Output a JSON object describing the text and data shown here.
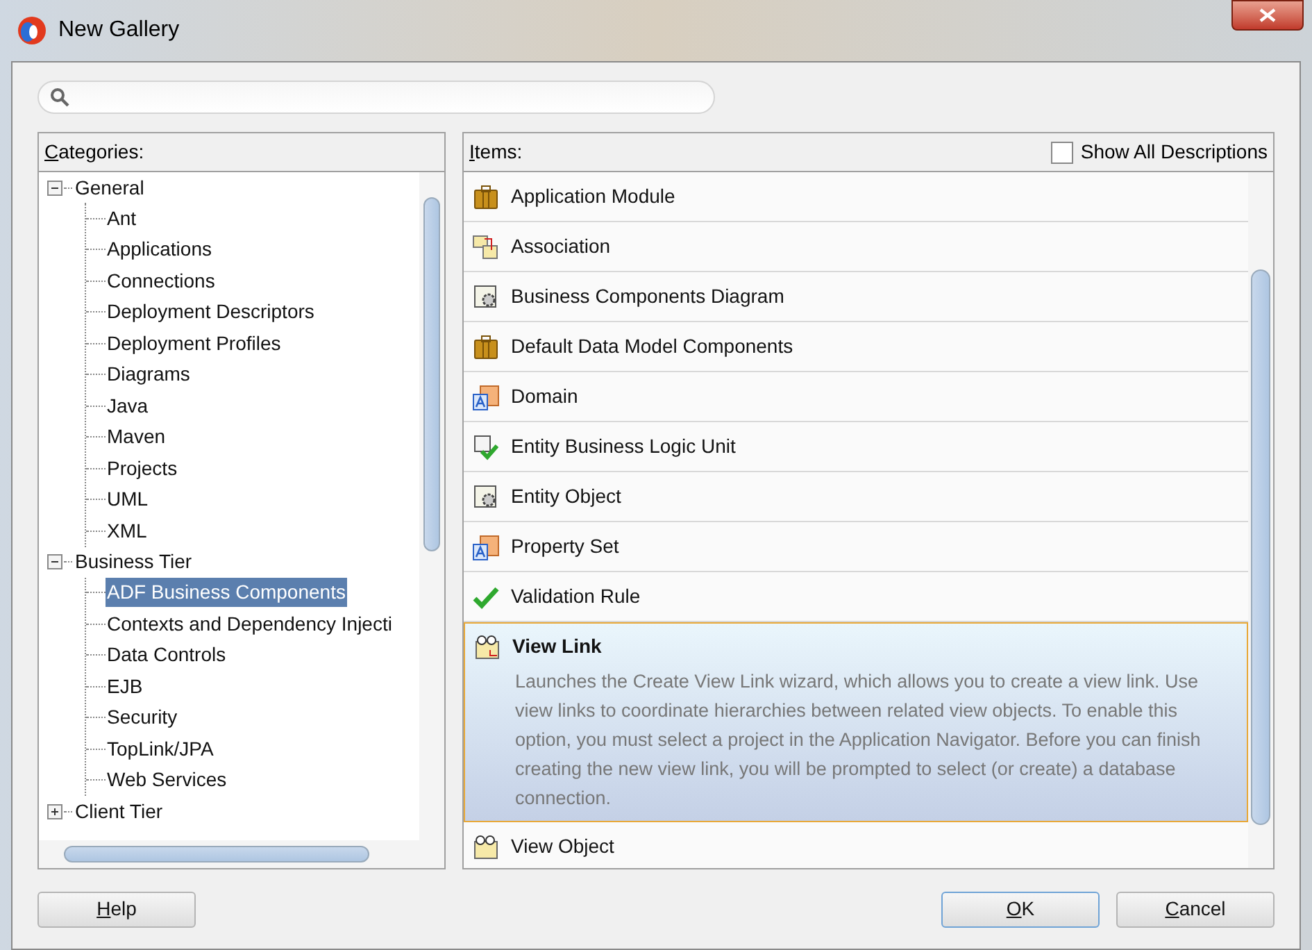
{
  "window": {
    "title": "New Gallery"
  },
  "categories": {
    "label": "Categories:",
    "tree": [
      {
        "label": "General",
        "expanded": true,
        "selected": false,
        "children": [
          {
            "label": "Ant",
            "selected": false
          },
          {
            "label": "Applications",
            "selected": false
          },
          {
            "label": "Connections",
            "selected": false
          },
          {
            "label": "Deployment Descriptors",
            "selected": false
          },
          {
            "label": "Deployment Profiles",
            "selected": false
          },
          {
            "label": "Diagrams",
            "selected": false
          },
          {
            "label": "Java",
            "selected": false
          },
          {
            "label": "Maven",
            "selected": false
          },
          {
            "label": "Projects",
            "selected": false
          },
          {
            "label": "UML",
            "selected": false
          },
          {
            "label": "XML",
            "selected": false
          }
        ]
      },
      {
        "label": "Business Tier",
        "expanded": true,
        "selected": false,
        "children": [
          {
            "label": "ADF Business Components",
            "selected": true
          },
          {
            "label": "Contexts and Dependency Injecti",
            "selected": false
          },
          {
            "label": "Data Controls",
            "selected": false
          },
          {
            "label": "EJB",
            "selected": false
          },
          {
            "label": "Security",
            "selected": false
          },
          {
            "label": "TopLink/JPA",
            "selected": false
          },
          {
            "label": "Web Services",
            "selected": false
          }
        ]
      },
      {
        "label": "Client Tier",
        "expanded": false,
        "selected": false
      }
    ]
  },
  "items": {
    "label": "Items:",
    "show_all_descriptions": {
      "label": "Show All Descriptions",
      "checked": false
    },
    "list": [
      {
        "label": "Application Module",
        "selected": false
      },
      {
        "label": "Association",
        "selected": false
      },
      {
        "label": "Business Components Diagram",
        "selected": false
      },
      {
        "label": "Default Data Model Components",
        "selected": false
      },
      {
        "label": "Domain",
        "selected": false
      },
      {
        "label": "Entity Business Logic Unit",
        "selected": false
      },
      {
        "label": "Entity Object",
        "selected": false
      },
      {
        "label": "Property Set",
        "selected": false
      },
      {
        "label": "Validation Rule",
        "selected": false
      },
      {
        "label": "View Link",
        "selected": true,
        "description": "Launches the Create View Link wizard, which allows you to create a view link. Use view links to coordinate hierarchies between related view objects. To enable this option, you must select a project in the Application Navigator. Before you can finish creating the new view link, you will be prompted to select (or create) a database connection."
      },
      {
        "label": "View Object",
        "selected": false
      }
    ]
  },
  "buttons": [
    {
      "label": "Help",
      "default": false
    },
    {
      "label": "OK",
      "default": true
    },
    {
      "label": "Cancel",
      "default": false
    }
  ]
}
